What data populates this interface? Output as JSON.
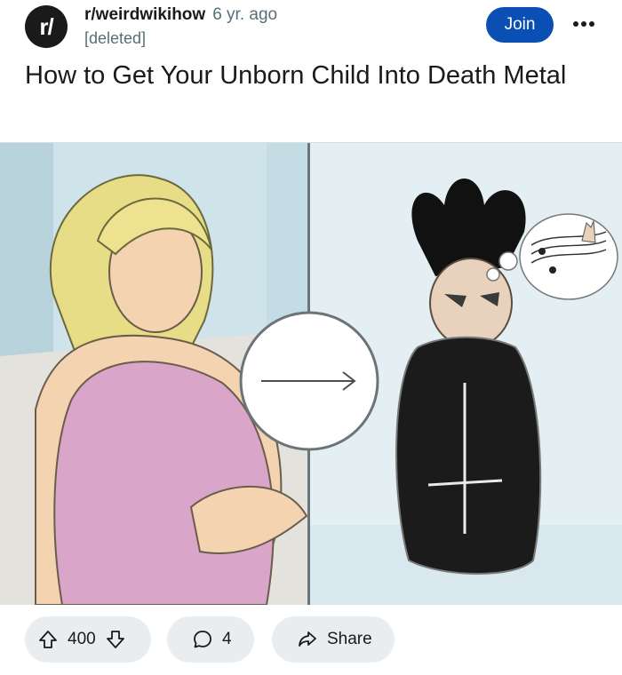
{
  "post": {
    "subreddit_initial": "r/",
    "subreddit": "r/weirdwikihow",
    "age": "6 yr. ago",
    "author": "[deleted]",
    "join_label": "Join",
    "title": "How to Get Your Unborn Child Into Death Metal"
  },
  "actions": {
    "score": "400",
    "comments": "4",
    "share_label": "Share"
  },
  "colors": {
    "join_bg": "#0a4fb3",
    "pill_bg": "#eaedef",
    "meta_gray": "#576f76"
  },
  "icons": [
    "more-icon",
    "upvote-icon",
    "downvote-icon",
    "comment-icon",
    "share-icon",
    "arrow-right-icon"
  ]
}
